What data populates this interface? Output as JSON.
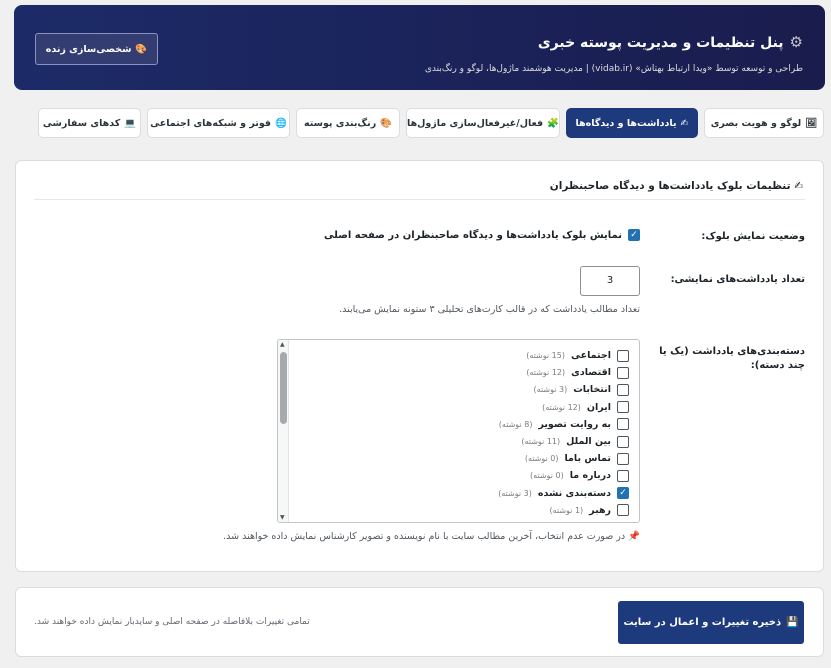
{
  "header": {
    "title": "پنل تنظیمات و مدیریت پوسته خبری",
    "subtitle": "طراحی و توسعه توسط «ویدا ارتباط بهتاش» (vidab.ir) | مدیریت هوشمند ماژول‌ها، لوگو و رنگ‌بندی",
    "live_button": "شخصی‌سازی زنده",
    "background_color": "#1c2b68"
  },
  "tabs": [
    {
      "label": "لوگو و هویت بصری",
      "icon": "🖼"
    },
    {
      "label": "یادداشت‌ها و دیدگاه‌ها",
      "icon": "✍",
      "active": true
    },
    {
      "label": "فعال/غیرفعال‌سازی ماژول‌ها",
      "icon": "🧩"
    },
    {
      "label": "رنگ‌بندی پوسته",
      "icon": "🎨"
    },
    {
      "label": "فوتر و شبکه‌های اجتماعی",
      "icon": "🌐"
    },
    {
      "label": "کدهای سفارشی",
      "icon": "💻"
    }
  ],
  "section": {
    "icon": "✍",
    "title": "تنظیمات بلوک یادداشت‌ها و دیدگاه صاحبنظران",
    "display_status": {
      "label": "وضعیت نمایش بلوک:",
      "checkbox_label": "نمایش بلوک یادداشت‌ها و دیدگاه صاحبنظران در صفحه اصلی",
      "checked": true
    },
    "count": {
      "label": "تعداد یادداشت‌های نمایشی:",
      "value": "3",
      "help": "تعداد مطالب یادداشت که در قالب کارت‌های تحلیلی ۳ ستونه نمایش می‌یابند."
    },
    "categories": {
      "label": "دسته‌بندی‌های یادداشت (یک یا چند دسته):",
      "items": [
        {
          "name": "اجتماعی",
          "count": "(15 نوشته)",
          "checked": false
        },
        {
          "name": "اقتصادی",
          "count": "(12 نوشته)",
          "checked": false
        },
        {
          "name": "انتخابات",
          "count": "(3 نوشته)",
          "checked": false
        },
        {
          "name": "ایران",
          "count": "(12 نوشته)",
          "checked": false
        },
        {
          "name": "به روایت تصویر",
          "count": "(8 نوشته)",
          "checked": false
        },
        {
          "name": "بین الملل",
          "count": "(11 نوشته)",
          "checked": false
        },
        {
          "name": "تماس باما",
          "count": "(0 نوشته)",
          "checked": false
        },
        {
          "name": "درباره ما",
          "count": "(0 نوشته)",
          "checked": false
        },
        {
          "name": "دسته‌بندی نشده",
          "count": "(3 نوشته)",
          "checked": true
        },
        {
          "name": "رهبر",
          "count": "(1 نوشته)",
          "checked": false
        }
      ],
      "note_icon": "📌",
      "note": "در صورت عدم انتخاب، آخرین مطالب سایت با نام نویسنده و تصویر کارشناس نمایش داده خواهند شد."
    }
  },
  "footer": {
    "save_icon": "💾",
    "save_button": "ذخیره تغییرات و اعمال در سایت",
    "note": "تمامی تغییرات بلافاصله در صفحه اصلی و سایدبار نمایش داده خواهند شد.",
    "accent_color": "#1d3a7c"
  }
}
